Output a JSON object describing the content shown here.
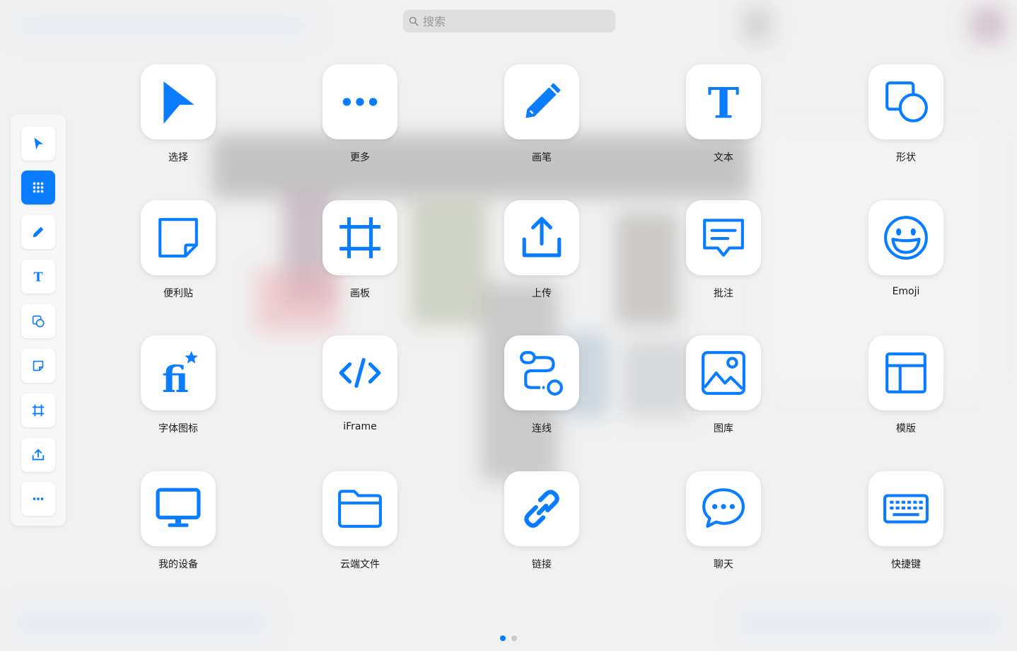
{
  "search": {
    "placeholder": "搜索",
    "icon": "search-icon"
  },
  "colors": {
    "accent": "#0a7cff",
    "tile": "#ffffff",
    "background": "#efefef"
  },
  "toolbar": {
    "tools": [
      {
        "name": "select",
        "icon": "pointer-icon",
        "active": false
      },
      {
        "name": "apps",
        "icon": "grid-dots-icon",
        "active": true
      },
      {
        "name": "pen",
        "icon": "pencil-icon",
        "active": false
      },
      {
        "name": "text",
        "icon": "text-t-icon",
        "active": false
      },
      {
        "name": "shape",
        "icon": "shapes-icon",
        "active": false
      },
      {
        "name": "sticky",
        "icon": "sticky-note-icon",
        "active": false
      },
      {
        "name": "frame",
        "icon": "frame-icon",
        "active": false
      },
      {
        "name": "upload",
        "icon": "upload-icon",
        "active": false
      },
      {
        "name": "more",
        "icon": "more-dots-icon",
        "active": false
      }
    ]
  },
  "apps": [
    {
      "label": "选择",
      "icon": "pointer-icon"
    },
    {
      "label": "更多",
      "icon": "more-dots-icon"
    },
    {
      "label": "画笔",
      "icon": "pencil-icon"
    },
    {
      "label": "文本",
      "icon": "text-t-icon"
    },
    {
      "label": "形状",
      "icon": "shapes-icon"
    },
    {
      "label": "便利贴",
      "icon": "sticky-note-icon"
    },
    {
      "label": "画板",
      "icon": "frame-icon"
    },
    {
      "label": "上传",
      "icon": "upload-icon"
    },
    {
      "label": "批注",
      "icon": "comment-icon"
    },
    {
      "label": "Emoji",
      "icon": "smiley-icon"
    },
    {
      "label": "字体图标",
      "icon": "font-icon-icon"
    },
    {
      "label": "iFrame",
      "icon": "code-icon"
    },
    {
      "label": "连线",
      "icon": "connector-icon"
    },
    {
      "label": "图库",
      "icon": "image-gallery-icon"
    },
    {
      "label": "模版",
      "icon": "template-icon"
    },
    {
      "label": "我的设备",
      "icon": "monitor-icon"
    },
    {
      "label": "云端文件",
      "icon": "folder-icon"
    },
    {
      "label": "链接",
      "icon": "link-icon"
    },
    {
      "label": "聊天",
      "icon": "chat-bubble-icon"
    },
    {
      "label": "快捷键",
      "icon": "keyboard-icon"
    }
  ],
  "pagination": {
    "pages": 2,
    "current": 1
  }
}
